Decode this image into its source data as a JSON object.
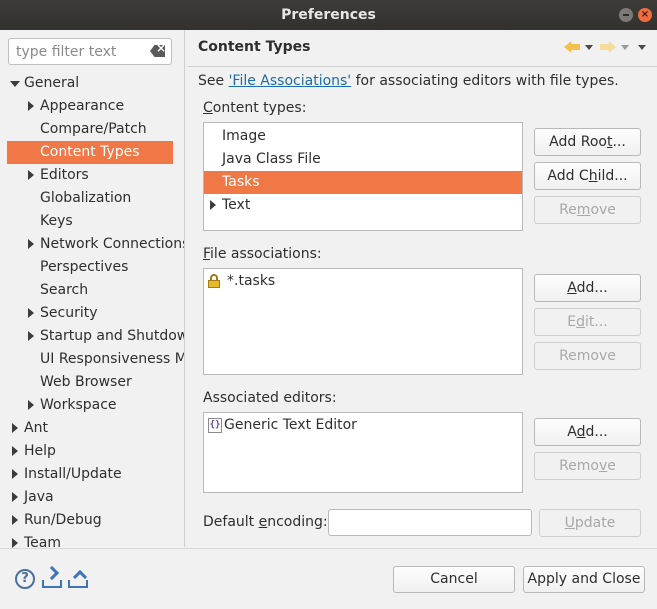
{
  "window": {
    "title": "Preferences"
  },
  "filter": {
    "placeholder": "type filter text"
  },
  "tree": [
    {
      "label": "General",
      "level": 0,
      "expander": "down",
      "selected": false
    },
    {
      "label": "Appearance",
      "level": 1,
      "expander": "right",
      "selected": false
    },
    {
      "label": "Compare/Patch",
      "level": 1,
      "expander": "none",
      "selected": false
    },
    {
      "label": "Content Types",
      "level": 1,
      "expander": "none",
      "selected": true
    },
    {
      "label": "Editors",
      "level": 1,
      "expander": "right",
      "selected": false
    },
    {
      "label": "Globalization",
      "level": 1,
      "expander": "none",
      "selected": false
    },
    {
      "label": "Keys",
      "level": 1,
      "expander": "none",
      "selected": false
    },
    {
      "label": "Network Connections",
      "level": 1,
      "expander": "right",
      "selected": false
    },
    {
      "label": "Perspectives",
      "level": 1,
      "expander": "none",
      "selected": false
    },
    {
      "label": "Search",
      "level": 1,
      "expander": "none",
      "selected": false
    },
    {
      "label": "Security",
      "level": 1,
      "expander": "right",
      "selected": false
    },
    {
      "label": "Startup and Shutdown",
      "level": 1,
      "expander": "right",
      "selected": false
    },
    {
      "label": "UI Responsiveness Monitoring",
      "level": 1,
      "expander": "none",
      "selected": false
    },
    {
      "label": "Web Browser",
      "level": 1,
      "expander": "none",
      "selected": false
    },
    {
      "label": "Workspace",
      "level": 1,
      "expander": "right",
      "selected": false
    },
    {
      "label": "Ant",
      "level": 0,
      "expander": "right",
      "selected": false
    },
    {
      "label": "Help",
      "level": 0,
      "expander": "right",
      "selected": false
    },
    {
      "label": "Install/Update",
      "level": 0,
      "expander": "right",
      "selected": false
    },
    {
      "label": "Java",
      "level": 0,
      "expander": "right",
      "selected": false
    },
    {
      "label": "Run/Debug",
      "level": 0,
      "expander": "right",
      "selected": false
    },
    {
      "label": "Team",
      "level": 0,
      "expander": "right",
      "selected": false
    }
  ],
  "page": {
    "title": "Content Types",
    "desc_prefix": "See ",
    "desc_link": "'File Associations'",
    "desc_suffix": " for associating editors with file types.",
    "content_types_label": {
      "pre": "",
      "mn": "C",
      "post": "ontent types:"
    },
    "content_types": [
      {
        "label": "Image",
        "expander": "none",
        "selected": false
      },
      {
        "label": "Java Class File",
        "expander": "none",
        "selected": false
      },
      {
        "label": "Tasks",
        "expander": "none",
        "selected": true
      },
      {
        "label": "Text",
        "expander": "right",
        "selected": false
      }
    ],
    "file_assoc_label": {
      "pre": "",
      "mn": "F",
      "post": "ile associations:"
    },
    "file_assoc": [
      {
        "label": "*.tasks",
        "icon": "lock-icon"
      }
    ],
    "editors_label": "Associated editors:",
    "editors": [
      {
        "label": "Generic Text Editor",
        "icon": "generic-editor-icon"
      }
    ],
    "encoding_label": {
      "pre": "Default ",
      "mn": "e",
      "post": "ncoding:"
    },
    "encoding_value": ""
  },
  "buttons": {
    "add_root": {
      "pre": "Add Roo",
      "mn": "t",
      "post": "...",
      "enabled": true
    },
    "add_child": {
      "pre": "Add C",
      "mn": "h",
      "post": "ild...",
      "enabled": true
    },
    "remove_type": {
      "pre": "Re",
      "mn": "m",
      "post": "ove",
      "enabled": false
    },
    "add_assoc": {
      "pre": "",
      "mn": "A",
      "post": "dd...",
      "enabled": true
    },
    "edit_assoc": {
      "pre": "E",
      "mn": "d",
      "post": "it...",
      "enabled": false
    },
    "remove_assoc": {
      "pre": "Remove",
      "mn": "",
      "post": "",
      "enabled": false
    },
    "add_editor": {
      "pre": "A",
      "mn": "d",
      "post": "d...",
      "enabled": true
    },
    "remove_editor": {
      "pre": "Remo",
      "mn": "v",
      "post": "e",
      "enabled": false
    },
    "update": {
      "pre": "",
      "mn": "U",
      "post": "pdate",
      "enabled": false
    },
    "cancel": {
      "pre": "Cancel",
      "mn": "",
      "post": "",
      "enabled": true
    },
    "apply_close": {
      "pre": "Apply and Close",
      "mn": "",
      "post": "",
      "enabled": true
    }
  },
  "colors": {
    "selection": "#f07746",
    "link": "#1b6ea8",
    "titlebar": "#3d3c38"
  }
}
